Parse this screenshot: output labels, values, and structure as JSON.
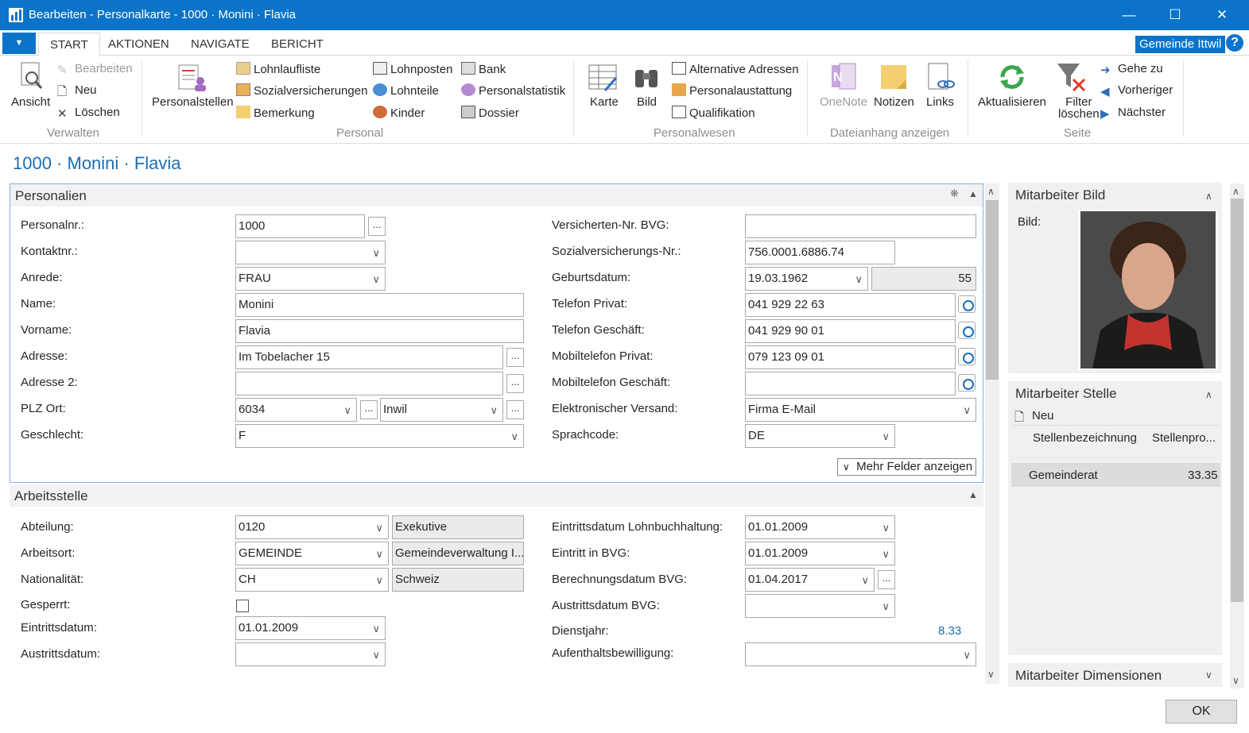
{
  "window": {
    "title": "Bearbeiten - Personalkarte - 1000 · Monini · Flavia"
  },
  "tabs": [
    "START",
    "AKTIONEN",
    "NAVIGATE",
    "BERICHT"
  ],
  "company": "Gemeinde Ittwil",
  "ribbon": {
    "verwalten": {
      "ansicht": "Ansicht",
      "bearbeiten": "Bearbeiten",
      "neu": "Neu",
      "loeschen": "Löschen",
      "group": "Verwalten"
    },
    "personal": {
      "personalstellen": "Personalstellen",
      "lohnlaufliste": "Lohnlaufliste",
      "sozialversicherungen": "Sozialversicherungen",
      "bemerkung": "Bemerkung",
      "lohnposten": "Lohnposten",
      "lohnteile": "Lohnteile",
      "kinder": "Kinder",
      "bank": "Bank",
      "personalstatistik": "Personalstatistik",
      "dossier": "Dossier",
      "group": "Personal"
    },
    "personalwesen": {
      "karte": "Karte",
      "bild": "Bild",
      "alternative_adressen": "Alternative Adressen",
      "personalaustattung": "Personalaustattung",
      "qualifikation": "Qualifikation",
      "group": "Personalwesen"
    },
    "dateianhang": {
      "onenote": "OneNote",
      "notizen": "Notizen",
      "links": "Links",
      "group": "Dateianhang anzeigen"
    },
    "seite": {
      "aktualisieren": "Aktualisieren",
      "filter_l1": "Filter",
      "filter_l2": "löschen",
      "gehe_zu": "Gehe zu",
      "vorheriger": "Vorheriger",
      "naechster": "Nächster",
      "group": "Seite"
    }
  },
  "page_title": "1000 · Monini · Flavia",
  "personalien": {
    "title": "Personalien",
    "personalnr_label": "Personalnr.:",
    "personalnr": "1000",
    "kontaktnr_label": "Kontaktnr.:",
    "kontaktnr": "",
    "anrede_label": "Anrede:",
    "anrede": "FRAU",
    "name_label": "Name:",
    "name": "Monini",
    "vorname_label": "Vorname:",
    "vorname": "Flavia",
    "adresse_label": "Adresse:",
    "adresse": "Im Tobelacher 15",
    "adresse2_label": "Adresse 2:",
    "adresse2": "",
    "plz_label": "PLZ Ort:",
    "plz": "6034",
    "ort": "Inwil",
    "geschlecht_label": "Geschlecht:",
    "geschlecht": "F",
    "bvg_nr_label": "Versicherten-Nr. BVG:",
    "bvg_nr": "",
    "sv_nr_label": "Sozialversicherungs-Nr.:",
    "sv_nr": "756.0001.6886.74",
    "geburtsdatum_label": "Geburtsdatum:",
    "geburtsdatum": "19.03.1962",
    "alter": "55",
    "tel_privat_label": "Telefon Privat:",
    "tel_privat": "041 929 22 63",
    "tel_geschaeft_label": "Telefon Geschäft:",
    "tel_geschaeft": "041 929 90 01",
    "mobil_privat_label": "Mobiltelefon Privat:",
    "mobil_privat": "079 123 09 01",
    "mobil_geschaeft_label": "Mobiltelefon Geschäft:",
    "mobil_geschaeft": "",
    "versand_label": "Elektronischer Versand:",
    "versand": "Firma E-Mail",
    "sprachcode_label": "Sprachcode:",
    "sprachcode": "DE",
    "mehr_felder": "Mehr Felder anzeigen"
  },
  "arbeitsstelle": {
    "title": "Arbeitsstelle",
    "abteilung_label": "Abteilung:",
    "abteilung": "0120",
    "abteilung_name": "Exekutive",
    "arbeitsort_label": "Arbeitsort:",
    "arbeitsort": "GEMEINDE",
    "arbeitsort_name": "Gemeindeverwaltung I...",
    "nationalitaet_label": "Nationalität:",
    "nationalitaet": "CH",
    "nationalitaet_name": "Schweiz",
    "gesperrt_label": "Gesperrt:",
    "eintritt_label": "Eintrittsdatum:",
    "eintritt": "01.01.2009",
    "austritt_label": "Austrittsdatum:",
    "austritt": "",
    "eintritt_lohn_label": "Eintrittsdatum Lohnbuchhaltung:",
    "eintritt_lohn": "01.01.2009",
    "eintritt_bvg_label": "Eintritt in BVG:",
    "eintritt_bvg": "01.01.2009",
    "berechnung_bvg_label": "Berechnungsdatum BVG:",
    "berechnung_bvg": "01.04.2017",
    "austritt_bvg_label": "Austrittsdatum BVG:",
    "austritt_bvg": "",
    "dienstjahr_label": "Dienstjahr:",
    "dienstjahr": "8.33",
    "aufenthalt_label": "Aufenthaltsbewilligung:",
    "aufenthalt": ""
  },
  "factbox": {
    "bild_title": "Mitarbeiter Bild",
    "bild_label": "Bild:",
    "stelle_title": "Mitarbeiter Stelle",
    "neu": "Neu",
    "col1": "Stellenbezeichnung",
    "col2": "Stellenpro...",
    "row_name": "Gemeinderat",
    "row_value": "33.35",
    "dimensionen_title": "Mitarbeiter Dimensionen"
  },
  "ok_label": "OK"
}
